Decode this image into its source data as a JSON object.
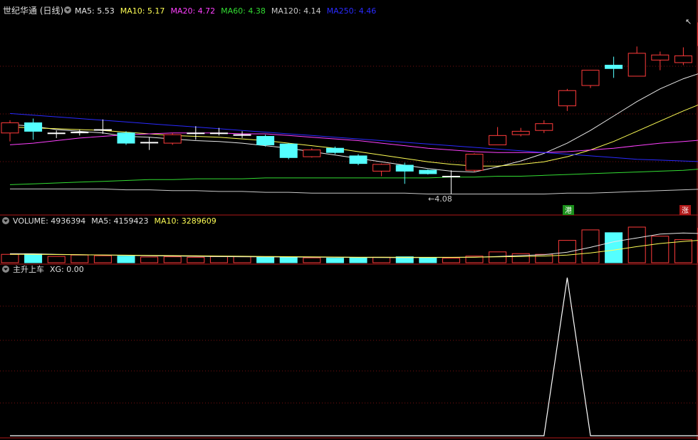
{
  "colors": {
    "background": "#000000",
    "up": "#ff3b3b",
    "down": "#54ffff",
    "grid": "#7a1010",
    "separator": "#b01818",
    "label_white": "#e0e0e0",
    "ma5": "#e8e8e8",
    "ma10": "#ffff55",
    "ma20": "#ff40ff",
    "ma60": "#33dd33",
    "ma120": "#c8c8c8",
    "ma250": "#2a2aff",
    "badge_green": "#1a8f1a",
    "badge_red": "#b01818"
  },
  "header": {
    "stock_title": "世纪华通 (日线)",
    "ma_labels": [
      {
        "text": "MA5: 5.53",
        "color": "#e8e8e8"
      },
      {
        "text": "MA10: 5.17",
        "color": "#ffff55"
      },
      {
        "text": "MA20: 4.72",
        "color": "#ff40ff"
      },
      {
        "text": "MA60: 4.38",
        "color": "#33dd33"
      },
      {
        "text": "MA120: 4.14",
        "color": "#c8c8c8"
      },
      {
        "text": "MA250: 4.46",
        "color": "#2a2aff"
      }
    ]
  },
  "volume_header": {
    "labels": [
      {
        "text": "VOLUME: 4936394",
        "color": "#e0e0e0"
      },
      {
        "text": "MA5: 4159423",
        "color": "#e0e0e0"
      },
      {
        "text": "MA10: 3289609",
        "color": "#ffff55"
      }
    ]
  },
  "indicator_header": {
    "labels": [
      {
        "text": "主升上车",
        "color": "#e0e0e0"
      },
      {
        "text": "XG: 0.00",
        "color": "#e0e0e0"
      }
    ]
  },
  "badges": {
    "hk": "港",
    "up_limit": "涨"
  },
  "annotations": {
    "low_marker": "←4.08"
  },
  "chart_data": {
    "type": "candlestick",
    "price_range": [
      3.95,
      6.15
    ],
    "candles": [
      {
        "o": 4.8,
        "c": 4.92,
        "h": 4.95,
        "l": 4.7
      },
      {
        "o": 4.92,
        "c": 4.82,
        "h": 4.97,
        "l": 4.72
      },
      {
        "o": 4.8,
        "c": 4.8,
        "h": 4.83,
        "l": 4.74
      },
      {
        "o": 4.81,
        "c": 4.81,
        "h": 4.84,
        "l": 4.77
      },
      {
        "o": 4.84,
        "c": 4.84,
        "h": 4.96,
        "l": 4.79
      },
      {
        "o": 4.8,
        "c": 4.68,
        "h": 4.82,
        "l": 4.66
      },
      {
        "o": 4.69,
        "c": 4.69,
        "h": 4.75,
        "l": 4.6
      },
      {
        "o": 4.68,
        "c": 4.78,
        "h": 4.8,
        "l": 4.66
      },
      {
        "o": 4.8,
        "c": 4.8,
        "h": 4.88,
        "l": 4.72
      },
      {
        "o": 4.8,
        "c": 4.8,
        "h": 4.86,
        "l": 4.77
      },
      {
        "o": 4.78,
        "c": 4.78,
        "h": 4.82,
        "l": 4.74
      },
      {
        "o": 4.76,
        "c": 4.66,
        "h": 4.78,
        "l": 4.64
      },
      {
        "o": 4.67,
        "c": 4.51,
        "h": 4.68,
        "l": 4.49
      },
      {
        "o": 4.52,
        "c": 4.6,
        "h": 4.62,
        "l": 4.51
      },
      {
        "o": 4.62,
        "c": 4.57,
        "h": 4.64,
        "l": 4.55
      },
      {
        "o": 4.53,
        "c": 4.44,
        "h": 4.55,
        "l": 4.42
      },
      {
        "o": 4.35,
        "c": 4.43,
        "h": 4.44,
        "l": 4.29
      },
      {
        "o": 4.42,
        "c": 4.35,
        "h": 4.45,
        "l": 4.2
      },
      {
        "o": 4.36,
        "c": 4.32,
        "h": 4.37,
        "l": 4.31
      },
      {
        "o": 4.29,
        "c": 4.29,
        "h": 4.36,
        "l": 4.08
      },
      {
        "o": 4.36,
        "c": 4.55,
        "h": 4.56,
        "l": 4.34
      },
      {
        "o": 4.66,
        "c": 4.77,
        "h": 4.87,
        "l": 4.66
      },
      {
        "o": 4.78,
        "c": 4.82,
        "h": 4.86,
        "l": 4.76
      },
      {
        "o": 4.83,
        "c": 4.91,
        "h": 4.95,
        "l": 4.8
      },
      {
        "o": 5.12,
        "c": 5.3,
        "h": 5.32,
        "l": 5.06
      },
      {
        "o": 5.36,
        "c": 5.54,
        "h": 5.54,
        "l": 5.33
      },
      {
        "o": 5.6,
        "c": 5.56,
        "h": 5.7,
        "l": 5.45
      },
      {
        "o": 5.47,
        "c": 5.74,
        "h": 5.82,
        "l": 5.47
      },
      {
        "o": 5.66,
        "c": 5.72,
        "h": 5.76,
        "l": 5.54
      },
      {
        "o": 5.63,
        "c": 5.71,
        "h": 5.81,
        "l": 5.6
      },
      {
        "o": 5.83,
        "c": 6.1,
        "h": 6.15,
        "l": 5.84
      }
    ],
    "ma": {
      "ma5": [
        4.9,
        4.88,
        4.84,
        4.82,
        4.8,
        4.76,
        4.75,
        4.73,
        4.71,
        4.7,
        4.68,
        4.65,
        4.62,
        4.58,
        4.54,
        4.5,
        4.46,
        4.42,
        4.38,
        4.35,
        4.34,
        4.4,
        4.47,
        4.56,
        4.68,
        4.83,
        5.0,
        5.17,
        5.32,
        5.44,
        5.53
      ],
      "ma10": [
        4.87,
        4.86,
        4.85,
        4.84,
        4.83,
        4.81,
        4.79,
        4.77,
        4.76,
        4.75,
        4.73,
        4.71,
        4.68,
        4.65,
        4.62,
        4.58,
        4.54,
        4.5,
        4.46,
        4.43,
        4.41,
        4.41,
        4.43,
        4.46,
        4.52,
        4.6,
        4.7,
        4.82,
        4.94,
        5.06,
        5.17
      ],
      "ma20": [
        4.66,
        4.68,
        4.71,
        4.74,
        4.76,
        4.78,
        4.79,
        4.8,
        4.8,
        4.8,
        4.79,
        4.79,
        4.77,
        4.75,
        4.73,
        4.71,
        4.68,
        4.65,
        4.62,
        4.6,
        4.58,
        4.57,
        4.57,
        4.57,
        4.58,
        4.6,
        4.62,
        4.65,
        4.68,
        4.7,
        4.72
      ],
      "ma60": [
        4.19,
        4.2,
        4.21,
        4.22,
        4.23,
        4.24,
        4.25,
        4.25,
        4.26,
        4.26,
        4.26,
        4.27,
        4.27,
        4.27,
        4.27,
        4.27,
        4.27,
        4.27,
        4.27,
        4.28,
        4.28,
        4.29,
        4.29,
        4.3,
        4.31,
        4.32,
        4.33,
        4.34,
        4.35,
        4.36,
        4.38
      ],
      "ma120": [
        4.14,
        4.14,
        4.14,
        4.14,
        4.14,
        4.13,
        4.13,
        4.12,
        4.12,
        4.11,
        4.11,
        4.1,
        4.1,
        4.09,
        4.09,
        4.09,
        4.09,
        4.09,
        4.08,
        4.08,
        4.08,
        4.08,
        4.08,
        4.08,
        4.09,
        4.09,
        4.1,
        4.11,
        4.12,
        4.13,
        4.14
      ],
      "ma250": [
        5.03,
        5.01,
        4.99,
        4.97,
        4.95,
        4.93,
        4.91,
        4.89,
        4.87,
        4.85,
        4.83,
        4.81,
        4.79,
        4.77,
        4.75,
        4.73,
        4.71,
        4.69,
        4.67,
        4.65,
        4.63,
        4.61,
        4.59,
        4.57,
        4.55,
        4.53,
        4.51,
        4.49,
        4.48,
        4.47,
        4.46
      ]
    },
    "volume": {
      "range": [
        0,
        5200000
      ],
      "values": [
        1200000,
        1250000,
        900000,
        1100000,
        1000000,
        950000,
        820000,
        850000,
        780000,
        880000,
        860000,
        820000,
        780000,
        700000,
        650000,
        700000,
        780000,
        850000,
        700000,
        650000,
        950000,
        1550000,
        1300000,
        1200000,
        3200000,
        4700000,
        4300000,
        5100000,
        3800000,
        3300000,
        4936394
      ],
      "ma5": [
        1300000,
        1280000,
        1200000,
        1150000,
        1100000,
        1060000,
        1000000,
        960000,
        920000,
        880000,
        860000,
        840000,
        820000,
        800000,
        770000,
        750000,
        730000,
        720000,
        740000,
        760000,
        800000,
        900000,
        1020000,
        1150000,
        1500000,
        2200000,
        3000000,
        3550000,
        4100000,
        4250000,
        4159423
      ],
      "ma10": [
        1200000,
        1190000,
        1170000,
        1140000,
        1110000,
        1080000,
        1050000,
        1020000,
        990000,
        960000,
        930000,
        900000,
        870000,
        840000,
        820000,
        800000,
        790000,
        780000,
        770000,
        780000,
        790000,
        840000,
        900000,
        960000,
        1100000,
        1400000,
        1800000,
        2300000,
        2750000,
        3050000,
        3289609
      ]
    },
    "indicator": {
      "name": "XG",
      "range": [
        0,
        1
      ],
      "values": [
        0,
        0,
        0,
        0,
        0,
        0,
        0,
        0,
        0,
        0,
        0,
        0,
        0,
        0,
        0,
        0,
        0,
        0,
        0,
        0,
        0,
        0,
        0,
        0,
        1,
        0,
        0,
        0,
        0,
        0,
        0
      ]
    },
    "grid": true
  }
}
